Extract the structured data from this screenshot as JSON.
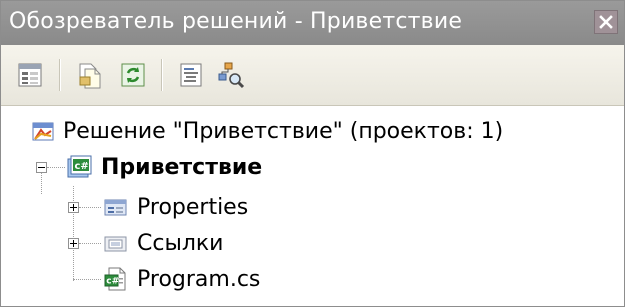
{
  "window": {
    "title": "Обозреватель решений - Приветствие",
    "close_icon": "close-icon"
  },
  "toolbar": {
    "buttons": [
      {
        "name": "properties-button",
        "icon": "properties-icon"
      },
      {
        "name": "show-all-files-button",
        "icon": "show-all-files-icon"
      },
      {
        "name": "refresh-button",
        "icon": "refresh-icon"
      },
      {
        "name": "view-code-button",
        "icon": "view-code-icon"
      },
      {
        "name": "class-view-button",
        "icon": "class-view-icon"
      }
    ]
  },
  "tree": {
    "solution": "Решение \"Приветствие\"  (проектов: 1)",
    "project": "Приветствие",
    "items": [
      {
        "label": "Properties",
        "expander": "collapsed"
      },
      {
        "label": "Ссылки",
        "expander": "collapsed"
      },
      {
        "label": "Program.cs",
        "expander": "none"
      }
    ]
  },
  "colors": {
    "title_bar": "#8f8f8f",
    "toolbar": "#efede4",
    "close_button": "#a09298"
  }
}
